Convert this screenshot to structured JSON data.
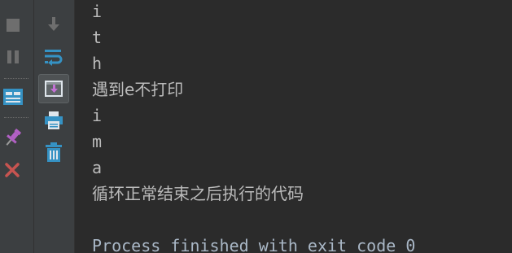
{
  "console": {
    "lines": [
      "i",
      "t",
      "h",
      "遇到e不打印",
      "i",
      "m",
      "a",
      "循环正常结束之后执行的代码",
      "",
      "Process finished with exit code 0"
    ]
  },
  "toolbar": {
    "left": [
      {
        "name": "run-icon",
        "color": "#499c54"
      },
      {
        "name": "stop-icon",
        "color": "#6e6e6e"
      },
      {
        "name": "pause-icon",
        "color": "#6e6e6e"
      },
      {
        "name": "layout-icon",
        "color": "#3592c4"
      },
      {
        "name": "pin-icon",
        "color": "#b160c4"
      },
      {
        "name": "close-icon",
        "color": "#c75450"
      }
    ],
    "right": [
      {
        "name": "scroll-down-icon",
        "color": "#6e6e6e"
      },
      {
        "name": "soft-wrap-icon",
        "color": "#3592c4"
      },
      {
        "name": "scroll-to-end-icon",
        "color": "#b160c4"
      },
      {
        "name": "print-icon",
        "color": "#3592c4"
      },
      {
        "name": "trash-icon",
        "color": "#3592c4"
      }
    ]
  }
}
